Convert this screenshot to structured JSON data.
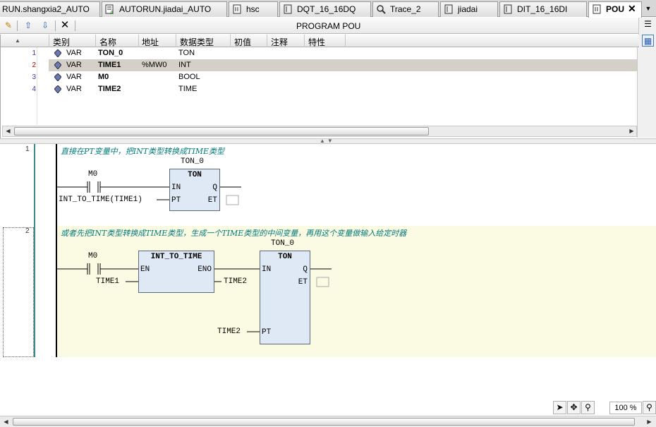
{
  "tabs": [
    {
      "label": "RUN.shangxia2_AUTO",
      "icon": "none"
    },
    {
      "label": "AUTORUN.jiadai_AUTO",
      "icon": "program-icon"
    },
    {
      "label": "hsc",
      "icon": "pou-icon"
    },
    {
      "label": "DQT_16_16DQ",
      "icon": "gvl-icon"
    },
    {
      "label": "Trace_2",
      "icon": "trace-icon"
    },
    {
      "label": "jiadai",
      "icon": "gvl-icon"
    },
    {
      "label": "DIT_16_16DI",
      "icon": "gvl-icon"
    },
    {
      "label": "POU",
      "icon": "pou-icon",
      "active": true
    }
  ],
  "toolbar": {
    "title": "PROGRAM POU"
  },
  "declaration": {
    "columns": [
      "类别",
      "名称",
      "地址",
      "数据类型",
      "初值",
      "注释",
      "特性"
    ],
    "rows": [
      {
        "num": "1",
        "scope": "VAR",
        "name": "TON_0",
        "address": "",
        "type": "TON"
      },
      {
        "num": "2",
        "scope": "VAR",
        "name": "TIME1",
        "address": "%MW0",
        "type": "INT"
      },
      {
        "num": "3",
        "scope": "VAR",
        "name": "M0",
        "address": "",
        "type": "BOOL"
      },
      {
        "num": "4",
        "scope": "VAR",
        "name": "TIME2",
        "address": "",
        "type": "TIME"
      }
    ]
  },
  "networks": [
    {
      "num": "1",
      "comment": "直接在PT变量中，把INT类型转换成TIME类型",
      "contact": "M0",
      "instance": "TON_0",
      "fb_type": "TON",
      "pins": {
        "in": "IN",
        "pt": "PT",
        "q": "Q",
        "et": "ET"
      },
      "pt_input": "INT_TO_TIME(TIME1)"
    },
    {
      "num": "2",
      "comment": "或者先把INT类型转换成TIME类型，生成一个TIME类型的中间变量，再用这个变量做输入给定时器",
      "contact": "M0",
      "conv_fb": "INT_TO_TIME",
      "conv_pins": {
        "en": "EN",
        "eno": "ENO"
      },
      "conv_input": "TIME1",
      "conv_output": "TIME2",
      "instance": "TON_0",
      "fb_type": "TON",
      "pins": {
        "in": "IN",
        "pt": "PT",
        "q": "Q",
        "et": "ET"
      },
      "pt_input": "TIME2"
    }
  ],
  "status": {
    "zoom": "100 %"
  }
}
